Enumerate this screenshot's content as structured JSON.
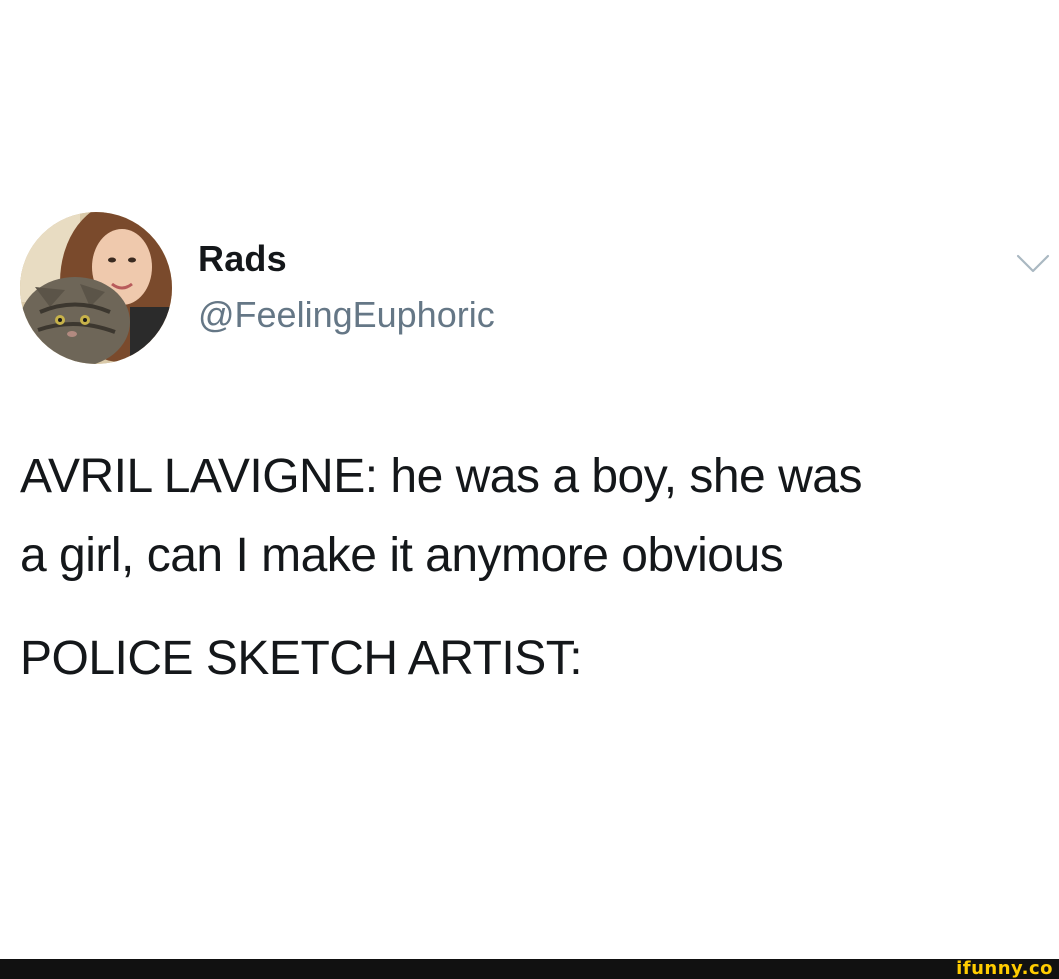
{
  "tweet": {
    "author": {
      "display_name": "Rads",
      "handle": "@FeelingEuphoric",
      "avatar": "profile-photo"
    },
    "menu_icon": "chevron-down-icon",
    "text_lines": [
      "AVRIL LAVIGNE: he was a boy, she was",
      "a girl, can I make it anymore obvious",
      "POLICE SKETCH ARTIST:"
    ]
  },
  "footer": {
    "watermark": "ifunny.co",
    "watermark_color": "#ffcc00"
  },
  "colors": {
    "name": "#14171a",
    "handle": "#657786",
    "background": "#ffffff"
  }
}
